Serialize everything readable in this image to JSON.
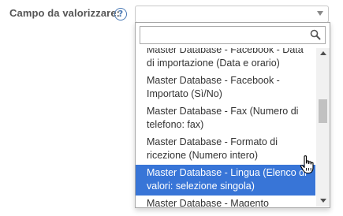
{
  "field": {
    "label": "Campo da valorizzare:",
    "help_icon": "?"
  },
  "select": {
    "selected_value": "",
    "arrow_icon": "chevron-down-icon"
  },
  "search": {
    "value": "",
    "placeholder": "",
    "icon": "search-icon"
  },
  "options": [
    {
      "label": "Master Database - Facebook - Data di importazione (Data e orario)",
      "highlighted": false
    },
    {
      "label": "Master Database - Facebook - Importato (Sì/No)",
      "highlighted": false
    },
    {
      "label": "Master Database - Fax (Numero di telefono: fax)",
      "highlighted": false
    },
    {
      "label": "Master Database - Formato di ricezione (Numero intero)",
      "highlighted": false
    },
    {
      "label": "Master Database - Lingua (Elenco di valori: selezione singola)",
      "highlighted": true
    },
    {
      "label": "Master Database - Magento customer Id (Numero intero)",
      "highlighted": false
    }
  ],
  "colors": {
    "highlight": "#3875d7",
    "help_icon": "#4a7ab5"
  },
  "cursor": "hand-pointer-icon"
}
